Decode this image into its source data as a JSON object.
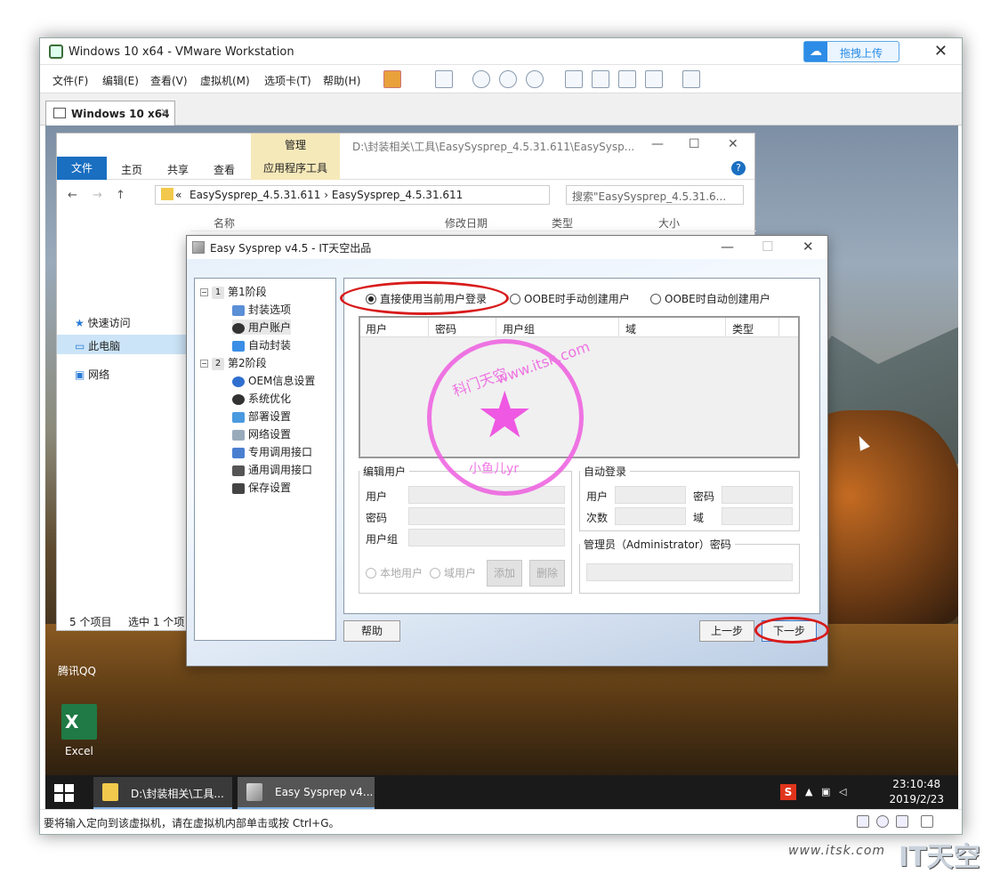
{
  "vm": {
    "title": "Windows 10 x64 - VMware Workstation",
    "upload_label": "拖拽上传",
    "close": "✕",
    "menu": [
      "文件(F)",
      "编辑(E)",
      "查看(V)",
      "虚拟机(M)",
      "选项卡(T)",
      "帮助(H)"
    ],
    "tab_label": "Windows 10 x64",
    "tab_close": "✕",
    "status_message": "要将输入定向到该虚拟机，请在虚拟机内部单击或按 Ctrl+G。"
  },
  "explorer": {
    "manage": "管理",
    "path": "D:\\封装相关\\工具\\EasySysprep_4.5.31.611\\EasySysp...",
    "ribbon": {
      "file": "文件",
      "home": "主页",
      "share": "共享",
      "view": "查看",
      "app_tools": "应用程序工具"
    },
    "address": "EasySysprep_4.5.31.611  ›  EasySysprep_4.5.31.611",
    "address_prefix": "«",
    "search_placeholder": "搜索\"EasySysprep_4.5.31.6...",
    "sidebar": {
      "quick_access": "快速访问",
      "this_pc": "此电脑",
      "network": "网络"
    },
    "columns": {
      "name": "名称",
      "modified": "修改日期",
      "type": "类型",
      "size": "大小"
    },
    "status_items": "5 个项目",
    "status_selected": "选中 1 个项"
  },
  "desktop": {
    "qq_label": "腾讯QQ",
    "excel_label": "Excel"
  },
  "dialog": {
    "title": "Easy Sysprep v4.5 - IT天空出品",
    "tree": [
      {
        "label": "第1阶段",
        "num": "1"
      },
      {
        "label": "封装选项"
      },
      {
        "label": "用户账户"
      },
      {
        "label": "自动封装"
      },
      {
        "label": "第2阶段",
        "num": "2"
      },
      {
        "label": "OEM信息设置"
      },
      {
        "label": "系统优化"
      },
      {
        "label": "部署设置"
      },
      {
        "label": "网络设置"
      },
      {
        "label": "专用调用接口"
      },
      {
        "label": "通用调用接口"
      },
      {
        "label": "保存设置"
      }
    ],
    "radio_options": [
      "直接使用当前用户登录",
      "OOBE时手动创建用户",
      "OOBE时自动创建用户"
    ],
    "selected_radio": 0,
    "table_headers": [
      "用户",
      "密码",
      "用户组",
      "域",
      "类型"
    ],
    "edit_user": {
      "legend": "编辑用户",
      "user": "用户",
      "password": "密码",
      "group": "用户组",
      "local_user": "本地用户",
      "domain_user": "域用户",
      "add": "添加",
      "delete": "删除"
    },
    "auto_login": {
      "legend": "自动登录",
      "user": "用户",
      "password": "密码",
      "count": "次数",
      "domain": "域"
    },
    "admin": {
      "legend": "管理员（Administrator）密码"
    },
    "buttons": {
      "help": "帮助",
      "prev": "上一步",
      "next": "下一步"
    },
    "stamp": {
      "url_text": "www.itsk.com",
      "name": "小鱼儿yr",
      "top_left": "科门天空"
    }
  },
  "taskbar": {
    "task1": "D:\\封装相关\\工具...",
    "task2": "Easy Sysprep v4...",
    "time": "23:10:48",
    "date": "2019/2/23"
  },
  "watermark": {
    "url": "www.itsk.com",
    "brand": "IT天空"
  },
  "colors": {
    "highlight_ring": "#d81b1b",
    "stamp": "#ee5ee0",
    "explorer_file_tab": "#1a6fc1"
  }
}
